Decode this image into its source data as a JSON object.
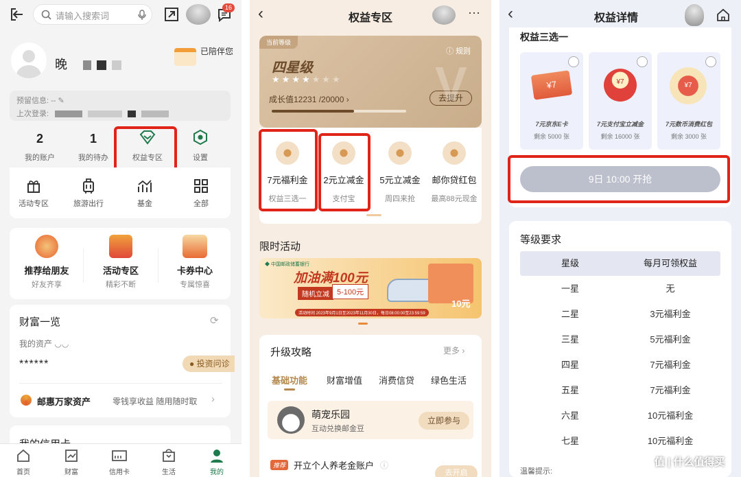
{
  "p1": {
    "search_placeholder": "请输入搜索词",
    "msg_badge": "16",
    "user_name": "晚",
    "days_label": "已陪伴您",
    "info_prefix": "预留信息:",
    "info_value": "--",
    "last_login": "上次登录:",
    "stats": [
      {
        "value": "2",
        "label": "我的账户"
      },
      {
        "value": "1",
        "label": "我的待办"
      },
      {
        "label": "权益专区"
      },
      {
        "label": "设置"
      }
    ],
    "grid": [
      "活动专区",
      "旅游出行",
      "基金",
      "全部"
    ],
    "promos": [
      {
        "title": "推荐给朋友",
        "sub": "好友齐享"
      },
      {
        "title": "活动专区",
        "sub": "精彩不断"
      },
      {
        "title": "卡券中心",
        "sub": "专属惊喜"
      }
    ],
    "wealth_title": "财富一览",
    "assets_label": "我的资产",
    "assets_value": "******",
    "invest_btn": "投资问诊",
    "youhui_title": "邮惠万家资产",
    "youhui_desc": "零钱享收益 随用随时取",
    "credit_title": "我的信用卡",
    "nav": [
      "首页",
      "财富",
      "信用卡",
      "生活",
      "我的"
    ]
  },
  "p2": {
    "title": "权益专区",
    "level_tag": "当前等级",
    "rules": "规则",
    "level": "四星级",
    "stars_filled": 4,
    "stars_total": 7,
    "growth": "成长值12231 /20000",
    "growth_fraction": 0.61,
    "upgrade_btn": "去提升",
    "benefits": [
      {
        "title": "7元福利金",
        "sub": "权益三选一"
      },
      {
        "title": "2元立减金",
        "sub": "支付宝"
      },
      {
        "title": "5元立减金",
        "sub": "周四来抢"
      },
      {
        "title": "邮你贷红包",
        "sub": "最高88元现金"
      }
    ],
    "limited_title": "限时活动",
    "banner_bank": "中国邮政储蓄银行",
    "banner_main": "加油满100元",
    "banner_tag1": "随机立减",
    "banner_tag2": "5-100元",
    "banner_footer": "活动时间 2023年9月1日至2023年11月30日，每日08:00:00至23:59:59",
    "banner_side": "10元",
    "strategy_title": "升级攻略",
    "more": "更多",
    "tabs": [
      "基础功能",
      "财富增值",
      "消费信贷",
      "绿色生活"
    ],
    "pet_title": "萌宠乐园",
    "pet_sub": "互动兑换邮金豆",
    "join_btn": "立即参与",
    "pension_tag": "推荐",
    "pension_text": "开立个人养老金账户",
    "open_btn": "去开启"
  },
  "p3": {
    "title": "权益详情",
    "choose_title": "权益三选一",
    "vouchers": [
      {
        "amount": "¥7",
        "name": "7元京东E卡",
        "remain": "剩余 5000 张"
      },
      {
        "amount": "¥7",
        "name": "7元支付宝立减金",
        "remain": "剩余 16000 张"
      },
      {
        "amount": "¥7",
        "name": "7元数币消费红包",
        "remain": "剩余 3000 张"
      }
    ],
    "grab_btn": "9日 10:00 开抢",
    "req_title": "等级要求",
    "table_headers": [
      "星级",
      "每月可领权益"
    ],
    "table_rows": [
      [
        "一星",
        "无"
      ],
      [
        "二星",
        "3元福利金"
      ],
      [
        "三星",
        "5元福利金"
      ],
      [
        "四星",
        "7元福利金"
      ],
      [
        "五星",
        "7元福利金"
      ],
      [
        "六星",
        "10元福利金"
      ],
      [
        "七星",
        "10元福利金"
      ]
    ],
    "tip": "温馨提示:",
    "watermark": "值 | 什么值得买"
  },
  "colors": {
    "green": "#1f7a4c",
    "red_box": "#e02418",
    "gold": "#a8875f",
    "orange": "#e88a3a"
  }
}
